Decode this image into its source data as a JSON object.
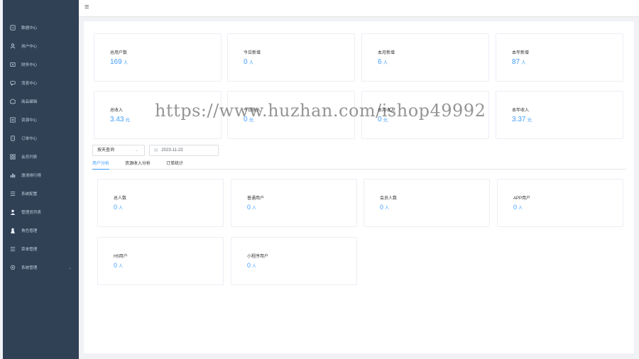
{
  "sidebar": {
    "items": [
      {
        "label": "数据中心",
        "icon": "dashboard-icon"
      },
      {
        "label": "用户中心",
        "icon": "user-icon"
      },
      {
        "label": "财务中心",
        "icon": "finance-icon"
      },
      {
        "label": "消息中心",
        "icon": "message-icon"
      },
      {
        "label": "商品编辑",
        "icon": "goods-icon"
      },
      {
        "label": "资源中心",
        "icon": "resource-icon"
      },
      {
        "label": "订单中心",
        "icon": "order-icon"
      },
      {
        "label": "会员列表",
        "icon": "member-list-icon"
      },
      {
        "label": "邀请排行榜",
        "icon": "ranking-icon"
      },
      {
        "label": "系统配置",
        "icon": "list-icon"
      },
      {
        "label": "管理员列表",
        "icon": "admin-icon"
      },
      {
        "label": "角色管理",
        "icon": "role-icon"
      },
      {
        "label": "菜单管理",
        "icon": "menu-icon"
      },
      {
        "label": "系统管理",
        "icon": "settings-icon",
        "arrow": "⌄"
      }
    ]
  },
  "topbar": {
    "hamburger": "≡"
  },
  "stats_row1": [
    {
      "label": "总用户数",
      "value": "169",
      "unit": "人"
    },
    {
      "label": "今日新增",
      "value": "0",
      "unit": "人"
    },
    {
      "label": "本月新增",
      "value": "6",
      "unit": "人"
    },
    {
      "label": "本年新增",
      "value": "87",
      "unit": "人"
    }
  ],
  "stats_row2": [
    {
      "label": "总收入",
      "value": "3.43",
      "unit": "元"
    },
    {
      "label": "今日收入",
      "value": "0",
      "unit": "元"
    },
    {
      "label": "本月收入",
      "value": "0",
      "unit": "元"
    },
    {
      "label": "本年收入",
      "value": "3.37",
      "unit": "元"
    }
  ],
  "filter": {
    "select_value": "按天查询",
    "select_chev": "⌄",
    "date_icon": "▤",
    "date_value": "2023-11-23"
  },
  "tabs": [
    {
      "label": "用户分析",
      "active": true
    },
    {
      "label": "资源收入分析",
      "active": false
    },
    {
      "label": "订单统计",
      "active": false
    }
  ],
  "analysis": [
    {
      "label": "总人数",
      "value": "0",
      "unit": "人"
    },
    {
      "label": "普通用户",
      "value": "0",
      "unit": "人"
    },
    {
      "label": "会员人数",
      "value": "0",
      "unit": "人"
    },
    {
      "label": "APP用户",
      "value": "0",
      "unit": "人"
    },
    {
      "label": "H5用户",
      "value": "0",
      "unit": "人"
    },
    {
      "label": "小程序用户",
      "value": "0",
      "unit": "人"
    }
  ],
  "watermark": "https://www.huzhan.com/ishop49992"
}
